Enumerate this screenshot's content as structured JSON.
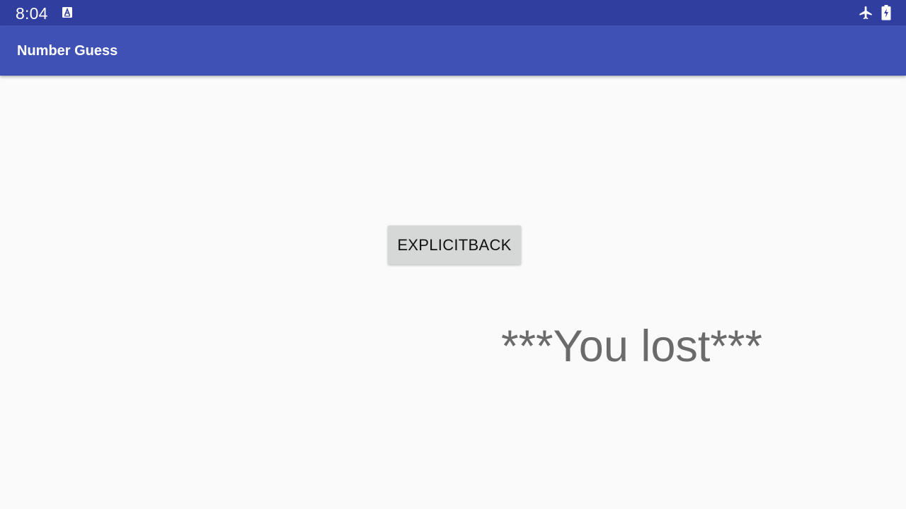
{
  "status_bar": {
    "time": "8:04",
    "background_color": "#303f9f",
    "notification_icon": "text-format-icon",
    "airplane_icon": "airplane-mode-icon",
    "battery_icon": "battery-charging-icon"
  },
  "app_bar": {
    "title": "Number Guess",
    "background_color": "#3f51b5"
  },
  "main": {
    "button_label": "EXPLICITBACK",
    "result_message": "***You lost***"
  }
}
